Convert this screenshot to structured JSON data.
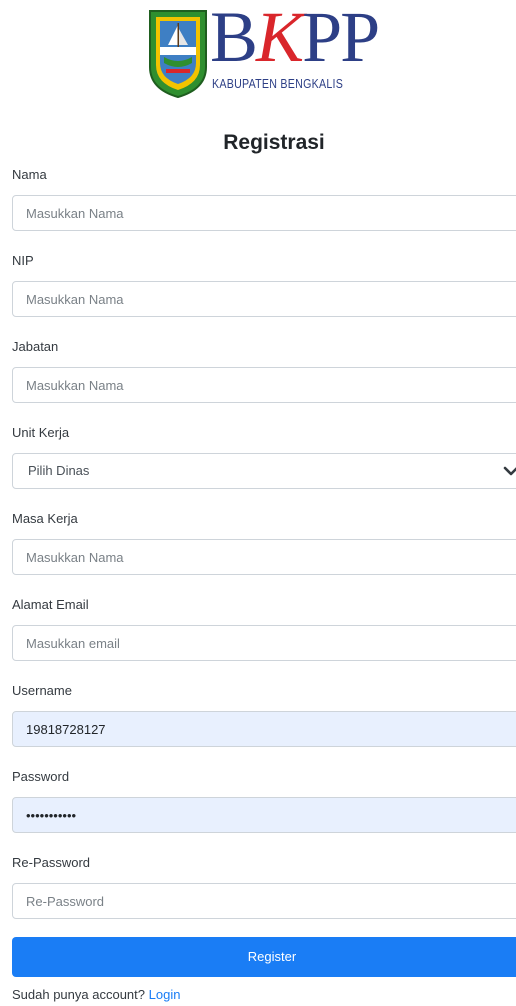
{
  "logo": {
    "brand": "BKPP",
    "brand_first": "B",
    "brand_red": "K",
    "brand_rest": "PP",
    "subtitle": "KABUPATEN BENGKALIS",
    "icon": "bengkalis-regency-emblem-icon",
    "colors": {
      "blue": "#2d3f86",
      "red": "#d9262b",
      "green": "#2f8f2f",
      "yellow": "#f2c300"
    }
  },
  "form": {
    "title": "Registrasi",
    "nama": {
      "label": "Nama",
      "placeholder": "Masukkan Nama",
      "value": ""
    },
    "nip": {
      "label": "NIP",
      "placeholder": "Masukkan Nama",
      "value": ""
    },
    "jabatan": {
      "label": "Jabatan",
      "placeholder": "Masukkan Nama",
      "value": ""
    },
    "unit_kerja": {
      "label": "Unit Kerja",
      "selected": "Pilih Dinas",
      "icon": "chevron-down-icon"
    },
    "masa_kerja": {
      "label": "Masa Kerja",
      "placeholder": "Masukkan Nama",
      "value": ""
    },
    "email": {
      "label": "Alamat Email",
      "placeholder": "Masukkan email",
      "value": ""
    },
    "username": {
      "label": "Username",
      "placeholder": "",
      "value": "19818728127"
    },
    "password": {
      "label": "Password",
      "placeholder": "",
      "value": "12345678901"
    },
    "repassword": {
      "label": "Re-Password",
      "placeholder": "Re-Password",
      "value": ""
    },
    "register_label": "Register"
  },
  "footer": {
    "prompt": "Sudah punya account?",
    "login_label": "Login"
  },
  "colors": {
    "primary": "#1a7df5",
    "autofill": "#e8f0fe",
    "border": "#ced4da"
  }
}
